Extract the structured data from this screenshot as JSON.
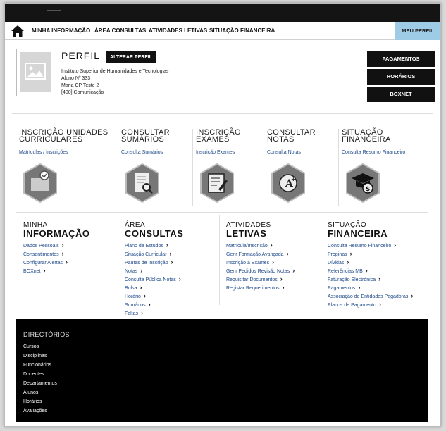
{
  "nav": {
    "items": [
      "MINHA INFORMAÇÃO",
      "ÁREA CONSULTAS",
      "ATIVIDADES LETIVAS",
      "SITUAÇÃO FINANCEIRA"
    ],
    "meu_perfil": "MEU PERFIL"
  },
  "profile": {
    "title": "PERFIL",
    "alterar": "ALTERAR PERFIL",
    "institution": "Instituto Superior de Humanidades e Tecnologias",
    "aluno": "Aluno Nº 333",
    "name": "Maria CP Teste 2",
    "course": "[400] Comunicação"
  },
  "right_buttons": [
    "PAGAMENTOS",
    "HORÁRIOS",
    "BOXNET"
  ],
  "tiles": [
    {
      "title1": "INSCRIÇÃO UNIDADES",
      "title2": "CURRICULARES",
      "link": "Matrículas / Inscrições",
      "icon": "certificate-check-icon"
    },
    {
      "title1": "CONSULTAR",
      "title2": "SUMÁRIOS",
      "link": "Consulta Sumários",
      "icon": "document-search-icon"
    },
    {
      "title1": "INSCRIÇÃO",
      "title2": "EXAMES",
      "link": "Inscrição Exames",
      "icon": "exam-pencil-icon"
    },
    {
      "title1": "CONSULTAR",
      "title2": "NOTAS",
      "link": "Consulta Notas",
      "icon": "grade-badge-icon"
    },
    {
      "title1": "SITUAÇÃO",
      "title2": "FINANCEIRA",
      "link": "Consulta Resumo Financeiro",
      "icon": "graduation-money-icon"
    }
  ],
  "columns": [
    {
      "h1": "MINHA",
      "h2": "INFORMAÇÃO",
      "links": [
        "Dados Pessoais",
        "Consentimentos",
        "Configurar Alertas",
        "BOXnet"
      ]
    },
    {
      "h1": "ÁREA",
      "h2": "CONSULTAS",
      "links": [
        "Plano de Estudos",
        "Situação Curricular",
        "Pautas de Inscrição",
        "Notas",
        "Consulta Pública Notas",
        "Bolsa",
        "Horário",
        "Sumários",
        "Faltas"
      ]
    },
    {
      "h1": "ATIVIDADES",
      "h2": "LETIVAS",
      "links": [
        "Matrícula/Inscrição",
        "Gerir Formação Avançada",
        "Inscrição a Exames",
        "Gerir Pedidos Revisão Notas",
        "Requisitar Documentos",
        "Registar Requerimentos"
      ]
    },
    {
      "h1": "SITUAÇÃO",
      "h2": "FINANCEIRA",
      "links": [
        "Consulta Resumo Financeiro",
        "Propinas",
        "Dívidas",
        "Referências MB",
        "Faturação Electrónica",
        "Pagamentos",
        "Associação de Entidades Pagadoras",
        "Planos de Pagamento"
      ]
    }
  ],
  "footer": {
    "title": "DIRECTÓRIOS",
    "links": [
      "Cursos",
      "Disciplinas",
      "Funcionários",
      "Docentes",
      "Departamentos",
      "Alunos",
      "Horários",
      "Avaliações"
    ]
  }
}
